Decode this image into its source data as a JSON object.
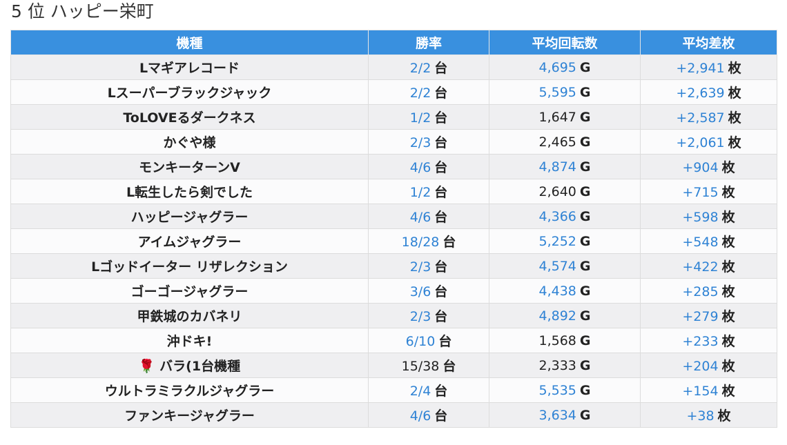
{
  "title": "5 位 ハッピー栄町",
  "headers": [
    "機種",
    "勝率",
    "平均回転数",
    "平均差枚"
  ],
  "colors": {
    "header_bg": "#3990df",
    "value_blue": "#2e82d4",
    "value_dark": "#222222"
  },
  "rows": [
    {
      "name": "Lマギアレコード",
      "win_rate": "2/2",
      "win_unit": "台",
      "win_blue": true,
      "spins": "4,695",
      "spins_unit": "G",
      "spins_blue": true,
      "diff": "+2,941",
      "diff_unit": "枚",
      "diff_blue": true
    },
    {
      "name": "Lスーパーブラックジャック",
      "win_rate": "2/2",
      "win_unit": "台",
      "win_blue": true,
      "spins": "5,595",
      "spins_unit": "G",
      "spins_blue": true,
      "diff": "+2,639",
      "diff_unit": "枚",
      "diff_blue": true
    },
    {
      "name": "ToLOVEるダークネス",
      "win_rate": "1/2",
      "win_unit": "台",
      "win_blue": true,
      "spins": "1,647",
      "spins_unit": "G",
      "spins_blue": false,
      "diff": "+2,587",
      "diff_unit": "枚",
      "diff_blue": true
    },
    {
      "name": "かぐや様",
      "win_rate": "2/3",
      "win_unit": "台",
      "win_blue": true,
      "spins": "2,465",
      "spins_unit": "G",
      "spins_blue": false,
      "diff": "+2,061",
      "diff_unit": "枚",
      "diff_blue": true
    },
    {
      "name": "モンキーターンV",
      "win_rate": "4/6",
      "win_unit": "台",
      "win_blue": true,
      "spins": "4,874",
      "spins_unit": "G",
      "spins_blue": true,
      "diff": "+904",
      "diff_unit": "枚",
      "diff_blue": true
    },
    {
      "name": "L転生したら剣でした",
      "win_rate": "1/2",
      "win_unit": "台",
      "win_blue": true,
      "spins": "2,640",
      "spins_unit": "G",
      "spins_blue": false,
      "diff": "+715",
      "diff_unit": "枚",
      "diff_blue": true
    },
    {
      "name": "ハッピージャグラー",
      "win_rate": "4/6",
      "win_unit": "台",
      "win_blue": true,
      "spins": "4,366",
      "spins_unit": "G",
      "spins_blue": true,
      "diff": "+598",
      "diff_unit": "枚",
      "diff_blue": true
    },
    {
      "name": "アイムジャグラー",
      "win_rate": "18/28",
      "win_unit": "台",
      "win_blue": true,
      "spins": "5,252",
      "spins_unit": "G",
      "spins_blue": true,
      "diff": "+548",
      "diff_unit": "枚",
      "diff_blue": true
    },
    {
      "name": "Lゴッドイーター リザレクション",
      "win_rate": "2/3",
      "win_unit": "台",
      "win_blue": true,
      "spins": "4,574",
      "spins_unit": "G",
      "spins_blue": true,
      "diff": "+422",
      "diff_unit": "枚",
      "diff_blue": true
    },
    {
      "name": "ゴーゴージャグラー",
      "win_rate": "3/6",
      "win_unit": "台",
      "win_blue": true,
      "spins": "4,438",
      "spins_unit": "G",
      "spins_blue": true,
      "diff": "+285",
      "diff_unit": "枚",
      "diff_blue": true
    },
    {
      "name": "甲鉄城のカバネリ",
      "win_rate": "2/3",
      "win_unit": "台",
      "win_blue": true,
      "spins": "4,892",
      "spins_unit": "G",
      "spins_blue": true,
      "diff": "+279",
      "diff_unit": "枚",
      "diff_blue": true
    },
    {
      "name": "沖ドキ!",
      "win_rate": "6/10",
      "win_unit": "台",
      "win_blue": true,
      "spins": "1,568",
      "spins_unit": "G",
      "spins_blue": false,
      "diff": "+233",
      "diff_unit": "枚",
      "diff_blue": true
    },
    {
      "name": "🌹 バラ(1台機種",
      "win_rate": "15/38",
      "win_unit": "台",
      "win_blue": false,
      "spins": "2,333",
      "spins_unit": "G",
      "spins_blue": false,
      "diff": "+204",
      "diff_unit": "枚",
      "diff_blue": true
    },
    {
      "name": "ウルトラミラクルジャグラー",
      "win_rate": "2/4",
      "win_unit": "台",
      "win_blue": true,
      "spins": "5,535",
      "spins_unit": "G",
      "spins_blue": true,
      "diff": "+154",
      "diff_unit": "枚",
      "diff_blue": true
    },
    {
      "name": "ファンキージャグラー",
      "win_rate": "4/6",
      "win_unit": "台",
      "win_blue": true,
      "spins": "3,634",
      "spins_unit": "G",
      "spins_blue": true,
      "diff": "+38",
      "diff_unit": "枚",
      "diff_blue": true
    }
  ]
}
